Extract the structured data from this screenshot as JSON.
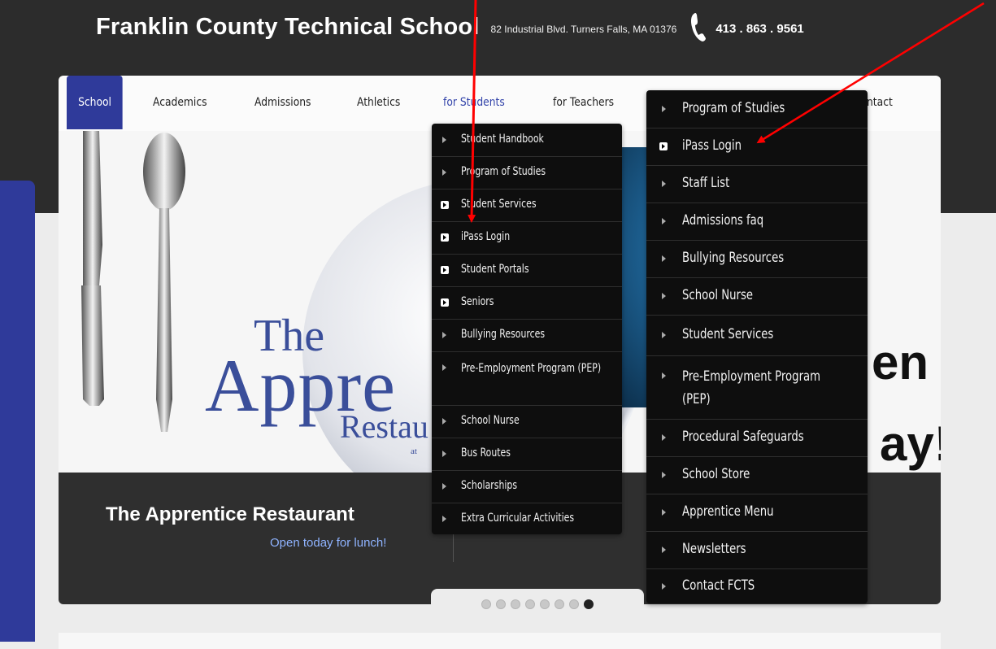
{
  "header": {
    "school_name": "Franklin County Technical School",
    "address": "82 Industrial Blvd.  Turners Falls, MA  01376",
    "phone": "413 . 863 . 9561"
  },
  "nav": {
    "items": [
      {
        "label": "School"
      },
      {
        "label": "Academics"
      },
      {
        "label": "Admissions"
      },
      {
        "label": "Athletics"
      },
      {
        "label": "for Students"
      },
      {
        "label": "for Teachers"
      },
      {
        "label": "Contact"
      }
    ],
    "contact_visible": "ntact"
  },
  "slide": {
    "the": "The",
    "appre": "Appre",
    "restau": "Restau",
    "at": "at",
    "big_en": "en",
    "big_y": "ay!"
  },
  "caption": {
    "title": "The Apprentice Restaurant",
    "subtitle": "Open today for lunch!"
  },
  "pager": {
    "count": 8,
    "active_index": 7
  },
  "students_menu": {
    "items": [
      {
        "label": "Student Handbook",
        "icon": "arrow-icon"
      },
      {
        "label": "Program of Studies",
        "icon": "arrow-icon"
      },
      {
        "label": "Student Services",
        "icon": "box-arrow-icon"
      },
      {
        "label": "iPass Login",
        "icon": "box-arrow-icon"
      },
      {
        "label": "Student Portals",
        "icon": "box-arrow-icon"
      },
      {
        "label": "Seniors",
        "icon": "box-arrow-icon"
      },
      {
        "label": "Bullying Resources",
        "icon": "arrow-icon"
      },
      {
        "label": "Pre-Employment Program (PEP)",
        "icon": "arrow-icon"
      },
      {
        "label": "School Nurse",
        "icon": "arrow-icon"
      },
      {
        "label": "Bus Routes",
        "icon": "arrow-icon"
      },
      {
        "label": "Scholarships",
        "icon": "arrow-icon"
      },
      {
        "label": "Extra Curricular Activities",
        "icon": "arrow-icon"
      }
    ]
  },
  "teachers_menu": {
    "items": [
      {
        "label": "Program of Studies",
        "icon": "arrow-icon"
      },
      {
        "label": "iPass Login",
        "icon": "box-arrow-icon"
      },
      {
        "label": "Staff List",
        "icon": "arrow-icon"
      },
      {
        "label": "Admissions faq",
        "icon": "arrow-icon"
      },
      {
        "label": "Bullying Resources",
        "icon": "arrow-icon"
      },
      {
        "label": "School Nurse",
        "icon": "arrow-icon"
      },
      {
        "label": "Student Services",
        "icon": "arrow-icon"
      },
      {
        "label": "Pre-Employment Program (PEP)",
        "icon": "arrow-icon"
      },
      {
        "label": "Procedural Safeguards",
        "icon": "arrow-icon"
      },
      {
        "label": "School Store",
        "icon": "arrow-icon"
      },
      {
        "label": "Apprentice Menu",
        "icon": "arrow-icon"
      },
      {
        "label": "Newsletters",
        "icon": "arrow-icon"
      },
      {
        "label": "Contact FCTS",
        "icon": "arrow-icon"
      }
    ]
  },
  "colors": {
    "accent": "#2f3a9a",
    "annotation": "#ff0000",
    "menu_bg": "#0e0e0e"
  }
}
